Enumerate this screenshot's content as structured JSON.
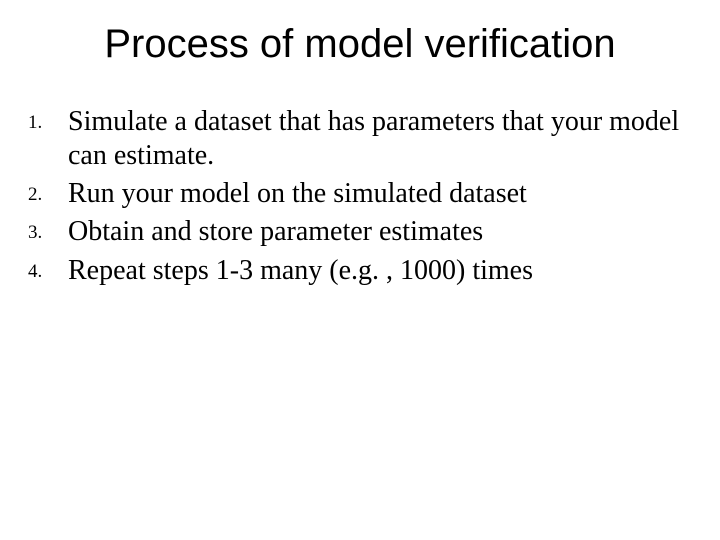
{
  "title": "Process of model verification",
  "items": [
    {
      "num": "1.",
      "text": "Simulate a dataset that has parameters that your model can estimate."
    },
    {
      "num": "2.",
      "text": "Run your model on the simulated dataset"
    },
    {
      "num": "3.",
      "text": "Obtain and store parameter estimates"
    },
    {
      "num": "4.",
      "text": "Repeat steps 1-3 many (e.g. , 1000) times"
    }
  ]
}
